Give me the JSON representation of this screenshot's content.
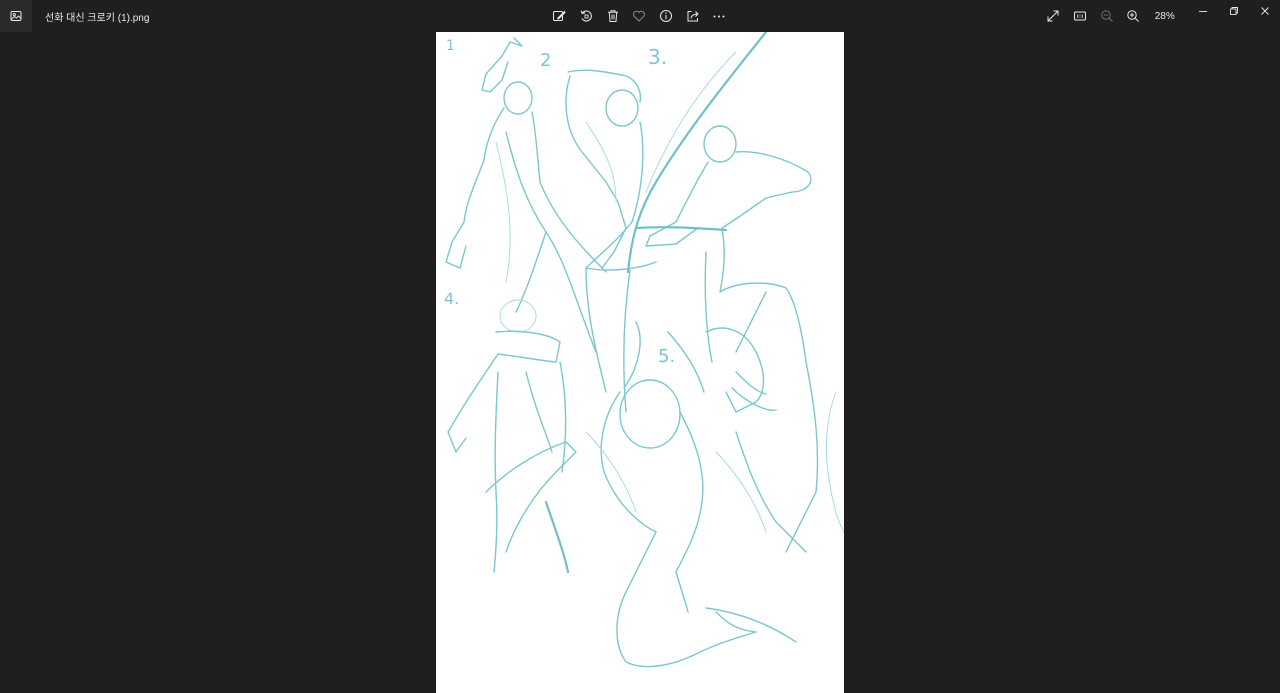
{
  "titlebar": {
    "file_name": "선화 대신 크로키 (1).png",
    "app_icon": "photos-app-icon"
  },
  "toolbar": {
    "center": [
      {
        "name": "edit-image-button",
        "icon": "edit-image-icon"
      },
      {
        "name": "rotate-button",
        "icon": "rotate-icon"
      },
      {
        "name": "delete-button",
        "icon": "trash-icon"
      },
      {
        "name": "favorite-button",
        "icon": "heart-icon"
      },
      {
        "name": "file-info-button",
        "icon": "info-icon"
      },
      {
        "name": "share-button",
        "icon": "share-icon"
      },
      {
        "name": "more-options-button",
        "icon": "more-icon"
      }
    ],
    "right": [
      {
        "name": "full-screen-button",
        "icon": "expand-icon"
      },
      {
        "name": "actual-size-button",
        "icon": "actual-size-icon"
      },
      {
        "name": "zoom-out-button",
        "icon": "zoom-out-icon"
      },
      {
        "name": "zoom-in-button",
        "icon": "zoom-in-icon"
      }
    ],
    "zoom_level": "28%"
  },
  "window_controls": {
    "minimize": "minimize-icon",
    "restore": "restore-icon",
    "close": "close-icon"
  },
  "image": {
    "stroke_color": "#7cc7cf",
    "background": "#ffffff",
    "pose_numbers": [
      "1",
      "2",
      "3.",
      "4.",
      "5."
    ]
  }
}
